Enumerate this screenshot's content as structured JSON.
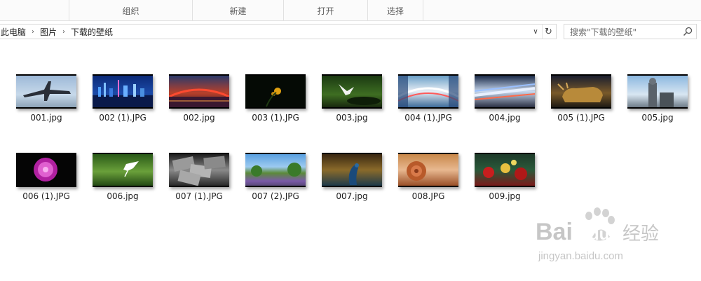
{
  "ribbon": {
    "groups": [
      "组织",
      "新建",
      "打开",
      "选择"
    ]
  },
  "address": {
    "crumbs": [
      "此电脑",
      "图片",
      "下载的壁纸"
    ]
  },
  "search": {
    "placeholder": "搜索\"下载的壁纸\""
  },
  "files": [
    {
      "name": "001.jpg",
      "icon": "airplane-thumbnail"
    },
    {
      "name": "002 (1).JPG",
      "icon": "city-night-blue-thumbnail"
    },
    {
      "name": "002.jpg",
      "icon": "bridge-night-thumbnail"
    },
    {
      "name": "003 (1).JPG",
      "icon": "dark-flower-thumbnail"
    },
    {
      "name": "003.jpg",
      "icon": "white-dove-thumbnail"
    },
    {
      "name": "004 (1).JPG",
      "icon": "highway-lights-thumbnail"
    },
    {
      "name": "004.jpg",
      "icon": "light-trails-thumbnail"
    },
    {
      "name": "005 (1).JPG",
      "icon": "bronze-bull-thumbnail"
    },
    {
      "name": "005.jpg",
      "icon": "statue-sky-thumbnail"
    },
    {
      "name": "006 (1).JPG",
      "icon": "pink-flower-thumbnail"
    },
    {
      "name": "006.jpg",
      "icon": "egret-thumbnail"
    },
    {
      "name": "007 (1).JPG",
      "icon": "banknotes-thumbnail"
    },
    {
      "name": "007 (2).JPG",
      "icon": "lavender-field-thumbnail"
    },
    {
      "name": "007.jpg",
      "icon": "peacock-thumbnail"
    },
    {
      "name": "008.JPG",
      "icon": "rose-thumbnail"
    },
    {
      "name": "009.jpg",
      "icon": "christmas-ornaments-thumbnail"
    }
  ],
  "watermark": {
    "brand_left": "Bai",
    "brand_right": "du",
    "brand_cn": "经验",
    "url": "jingyan.baidu.com"
  }
}
